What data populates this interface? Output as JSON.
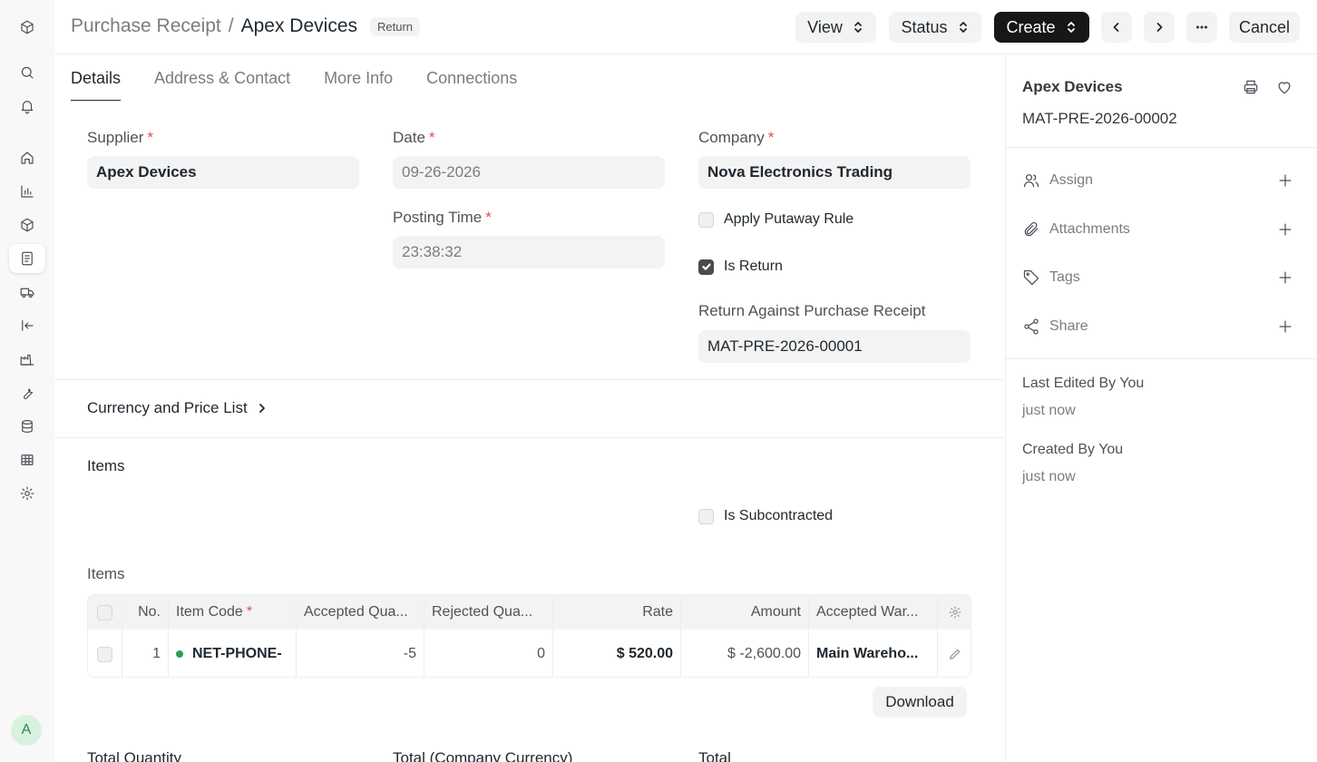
{
  "breadcrumb": {
    "parent": "Purchase Receipt",
    "separator": "/",
    "current": "Apex Devices",
    "badge": "Return"
  },
  "header": {
    "view_label": "View",
    "status_label": "Status",
    "create_label": "Create",
    "cancel_label": "Cancel"
  },
  "tabs": [
    {
      "label": "Details",
      "active": true
    },
    {
      "label": "Address & Contact",
      "active": false
    },
    {
      "label": "More Info",
      "active": false
    },
    {
      "label": "Connections",
      "active": false
    }
  ],
  "form": {
    "supplier": {
      "label": "Supplier",
      "required": "*",
      "value": "Apex Devices"
    },
    "date": {
      "label": "Date",
      "required": "*",
      "value": "09-26-2026"
    },
    "posting_time": {
      "label": "Posting Time",
      "required": "*",
      "value": "23:38:32"
    },
    "company": {
      "label": "Company",
      "required": "*",
      "value": "Nova Electronics Trading"
    },
    "apply_putaway_rule": {
      "label": "Apply Putaway Rule",
      "checked": false
    },
    "is_return": {
      "label": "Is Return",
      "checked": true
    },
    "return_against": {
      "label": "Return Against Purchase Receipt",
      "value": "MAT-PRE-2026-00001"
    }
  },
  "sections": {
    "currency": "Currency and Price List",
    "items": "Items",
    "is_subcontracted": "Is Subcontracted",
    "items_table_label": "Items"
  },
  "items_table": {
    "columns": {
      "no": "No.",
      "item_code": "Item Code",
      "item_code_req": "*",
      "accepted_qty": "Accepted Qua...",
      "rejected_qty": "Rejected Qua...",
      "rate": "Rate",
      "amount": "Amount",
      "accepted_wh": "Accepted War..."
    },
    "rows": [
      {
        "no": "1",
        "item_code": "NET-PHONE-",
        "accepted_qty": "-5",
        "rejected_qty": "0",
        "rate": "$ 520.00",
        "amount": "$ -2,600.00",
        "accepted_wh": "Main Wareho..."
      }
    ],
    "download_label": "Download"
  },
  "totals": {
    "total_quantity": "Total Quantity",
    "total_company_currency": "Total (Company Currency)",
    "total": "Total"
  },
  "sidebar": {
    "title": "Apex Devices",
    "doc_id": "MAT-PRE-2026-00002",
    "actions": [
      "Assign",
      "Attachments",
      "Tags",
      "Share"
    ],
    "last_edited_label": "Last Edited By You",
    "last_edited_value": "just now",
    "created_label": "Created By You",
    "created_value": "just now"
  },
  "user": {
    "initial": "A"
  },
  "colors": {
    "primary_button": "#171717",
    "status_dot": "#2c9e4f",
    "required": "#e24c4c"
  }
}
